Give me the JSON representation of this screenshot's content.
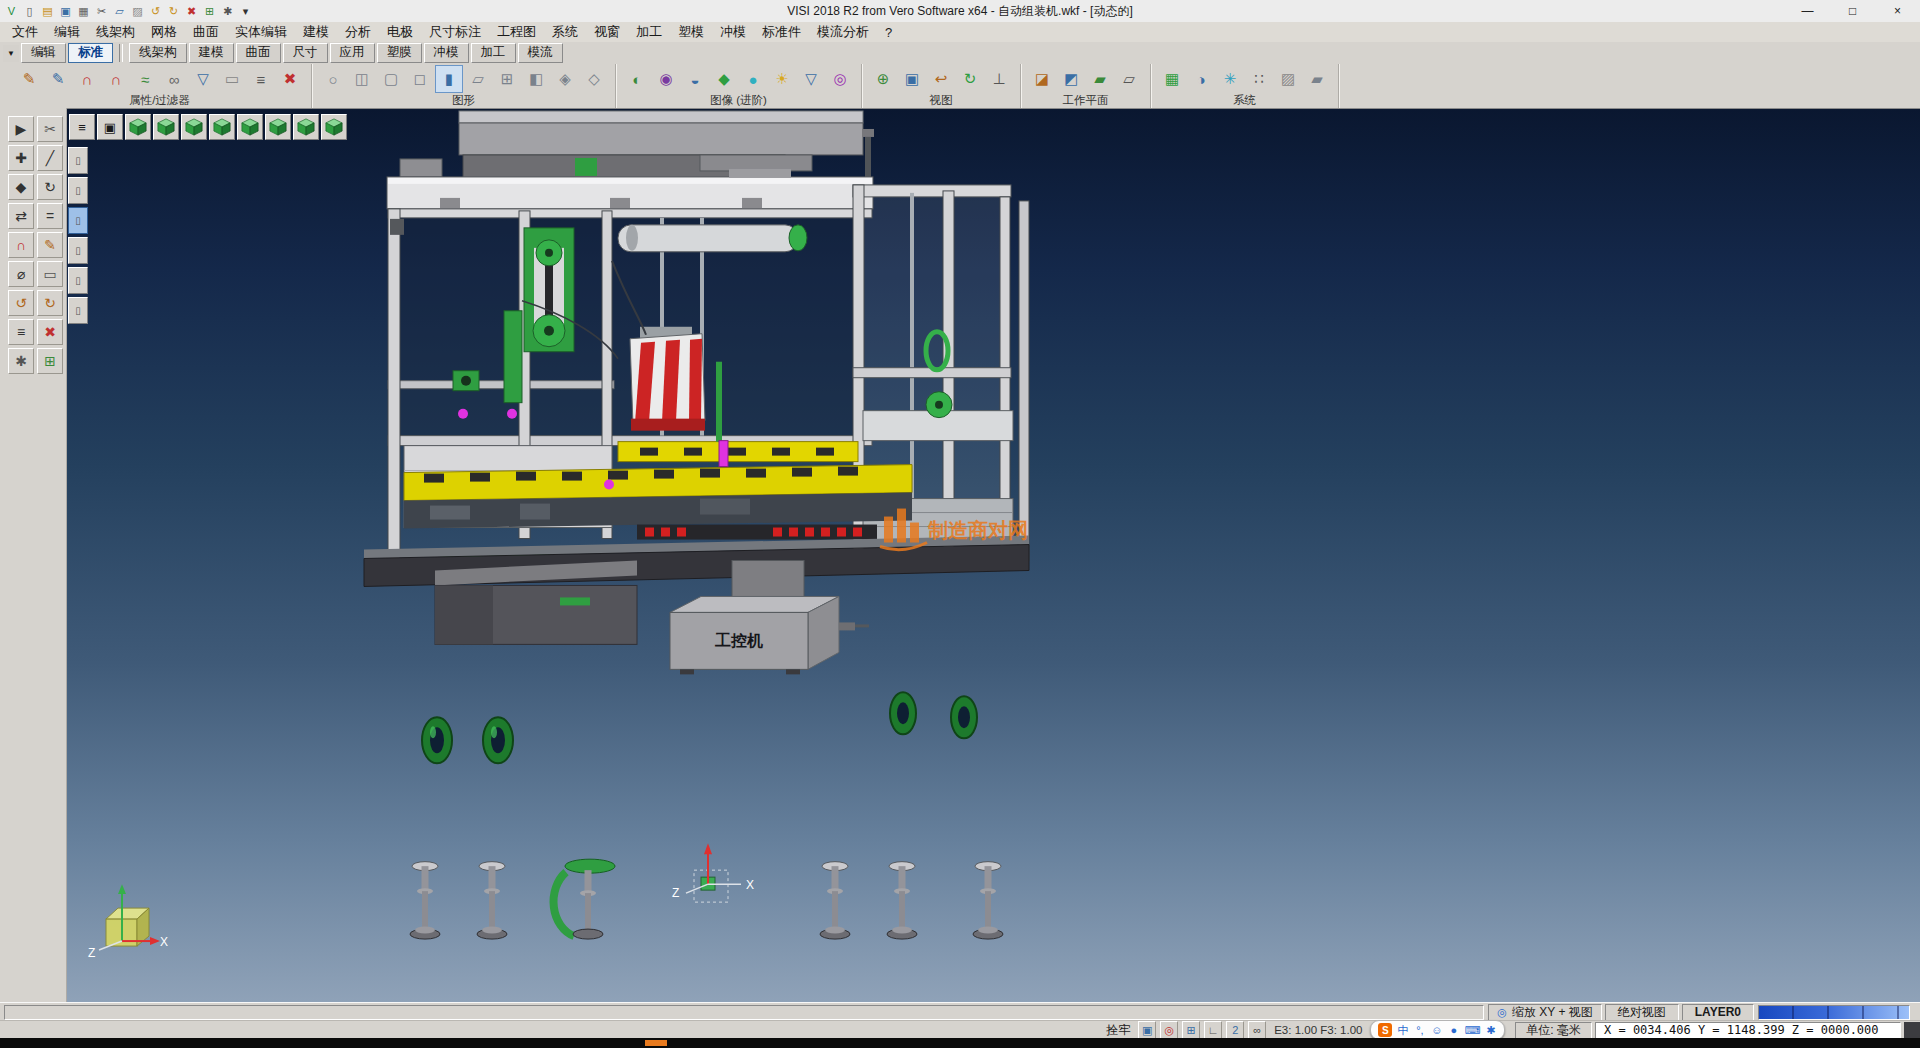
{
  "window": {
    "title": "VISI 2018 R2 from Vero Software x64 - 自动组装机.wkf - [动态的]",
    "controls": {
      "minimize": "—",
      "maximize": "□",
      "close": "×"
    },
    "quick_icons": [
      {
        "name": "visi-logo",
        "glyph": "V",
        "color": "#1c8c3c"
      },
      {
        "name": "new-file-icon",
        "glyph": "▯",
        "color": "#555555"
      },
      {
        "name": "open-file-icon",
        "glyph": "▤",
        "color": "#c89020"
      },
      {
        "name": "save-file-icon",
        "glyph": "▣",
        "color": "#3a6ea5"
      },
      {
        "name": "print-icon",
        "glyph": "▦",
        "color": "#666666"
      },
      {
        "name": "cut-icon",
        "glyph": "✂",
        "color": "#555555"
      },
      {
        "name": "copy-icon",
        "glyph": "▱",
        "color": "#3a6ea5"
      },
      {
        "name": "paste-icon",
        "glyph": "▨",
        "color": "#888888"
      },
      {
        "name": "undo-icon",
        "glyph": "↺",
        "color": "#c89020"
      },
      {
        "name": "redo-icon",
        "glyph": "↻",
        "color": "#c89020"
      },
      {
        "name": "delete-icon",
        "glyph": "✖",
        "color": "#c03030"
      },
      {
        "name": "grid-icon",
        "glyph": "⊞",
        "color": "#3a8a3a"
      },
      {
        "name": "options-icon",
        "glyph": "✱",
        "color": "#555555"
      },
      {
        "name": "more-commands-arrow",
        "glyph": "▾",
        "color": "#333333"
      }
    ]
  },
  "menubar": {
    "items": [
      {
        "label": "文件"
      },
      {
        "label": "编辑"
      },
      {
        "label": "线架构"
      },
      {
        "label": "网格"
      },
      {
        "label": "曲面"
      },
      {
        "label": "实体编辑"
      },
      {
        "label": "建模"
      },
      {
        "label": "分析"
      },
      {
        "label": "电极"
      },
      {
        "label": "尺寸标注"
      },
      {
        "label": "工程图"
      },
      {
        "label": "系统"
      },
      {
        "label": "视窗"
      },
      {
        "label": "加工"
      },
      {
        "label": "塑模"
      },
      {
        "label": "冲模"
      },
      {
        "label": "标准件"
      },
      {
        "label": "模流分析"
      },
      {
        "label": "?"
      }
    ]
  },
  "tabbar": {
    "dropdown": "▼",
    "left_tabs": [
      {
        "label": "编辑"
      },
      {
        "label": "标准",
        "cls": "active"
      }
    ],
    "right_tabs": [
      {
        "label": "线架构"
      },
      {
        "label": "建模"
      },
      {
        "label": "曲面"
      },
      {
        "label": "尺寸"
      },
      {
        "label": "应用"
      },
      {
        "label": "塑膜"
      },
      {
        "label": "冲模"
      },
      {
        "label": "加工"
      },
      {
        "label": "模流"
      }
    ]
  },
  "ribbon": {
    "groups": [
      {
        "label": "属性/过滤器",
        "icons": [
          {
            "name": "edit-attributes-icon",
            "glyph": "✎",
            "color": "#b06820"
          },
          {
            "name": "copy-attributes-icon",
            "glyph": "✎",
            "color": "#3a6ea5"
          },
          {
            "name": "magnet-filter-icon",
            "glyph": "∩",
            "color": "#c03030"
          },
          {
            "name": "magnet-select-icon",
            "glyph": "∩",
            "color": "#c03030"
          },
          {
            "name": "match-properties-icon",
            "glyph": "≈",
            "color": "#3a8a3a"
          },
          {
            "name": "link-elements-icon",
            "glyph": "∞",
            "color": "#666666"
          },
          {
            "name": "filter-icon",
            "glyph": "▽",
            "color": "#3a6ea5"
          },
          {
            "name": "erase-elements-icon",
            "glyph": "▭",
            "color": "#888888"
          },
          {
            "name": "layer-filter-icon",
            "glyph": "≡",
            "color": "#555555"
          },
          {
            "name": "reset-filter-icon",
            "glyph": "✖",
            "color": "#c03030"
          }
        ]
      },
      {
        "label": "图形",
        "icons": [
          {
            "name": "wireframe-view-icon",
            "glyph": "○",
            "color": "#7a828c"
          },
          {
            "name": "shaded-view-icon",
            "glyph": "◫",
            "color": "#7a828c"
          },
          {
            "name": "hidden-line-icon",
            "glyph": "▢",
            "color": "#7a828c"
          },
          {
            "name": "box-view-icon",
            "glyph": "◻",
            "color": "#7a828c"
          },
          {
            "name": "render-mode-icon",
            "glyph": "▮",
            "color": "#3a6ea5",
            "cls": "active"
          },
          {
            "name": "transparent-view-icon",
            "glyph": "▱",
            "color": "#7a828c"
          },
          {
            "name": "mesh-view-icon",
            "glyph": "⊞",
            "color": "#7a828c"
          },
          {
            "name": "half-section-icon",
            "glyph": "◧",
            "color": "#7a828c"
          },
          {
            "name": "gem-view-icon",
            "glyph": "◈",
            "color": "#7a828c"
          },
          {
            "name": "outline-view-icon",
            "glyph": "◇",
            "color": "#7a828c"
          }
        ]
      },
      {
        "label": "图像 (进阶)",
        "icons": [
          {
            "name": "render-settings-icon",
            "glyph": "◐",
            "color": "#3a8a3a"
          },
          {
            "name": "texture-view-icon",
            "glyph": "◉",
            "color": "#7a3aa0"
          },
          {
            "name": "shadow-view-icon",
            "glyph": "◒",
            "color": "#3a6ea5"
          },
          {
            "name": "material-icon",
            "glyph": "◆",
            "color": "#2f9e41"
          },
          {
            "name": "env-light-icon",
            "glyph": "●",
            "color": "#30b0c0"
          },
          {
            "name": "sun-light-icon",
            "glyph": "☀",
            "color": "#d8a820"
          },
          {
            "name": "clip-plane-icon",
            "glyph": "▽",
            "color": "#3a6ea5"
          },
          {
            "name": "analysis-view-icon",
            "glyph": "◎",
            "color": "#9a30b0"
          }
        ]
      },
      {
        "label": "视图",
        "icons": [
          {
            "name": "zoom-all-icon",
            "glyph": "⊕",
            "color": "#3a8a3a"
          },
          {
            "name": "zoom-window-icon",
            "glyph": "▣",
            "color": "#3a6ea5"
          },
          {
            "name": "previous-view-icon",
            "glyph": "↩",
            "color": "#b06820"
          },
          {
            "name": "rotate-view-icon",
            "glyph": "↻",
            "color": "#2f9e41"
          },
          {
            "name": "normal-view-icon",
            "glyph": "⊥",
            "color": "#555555"
          }
        ]
      },
      {
        "label": "工作平面",
        "icons": [
          {
            "name": "workplane-xy-icon",
            "glyph": "◪",
            "color": "#b06820"
          },
          {
            "name": "workplane-align-icon",
            "glyph": "◩",
            "color": "#3a6ea5"
          },
          {
            "name": "workplane-3pt-icon",
            "glyph": "▰",
            "color": "#3a8a3a"
          },
          {
            "name": "workplane-view-icon",
            "glyph": "▱",
            "color": "#555555"
          }
        ]
      },
      {
        "label": "系统",
        "icons": [
          {
            "name": "color-table-icon",
            "glyph": "▦",
            "color": "#2f9e41"
          },
          {
            "name": "globe-icon",
            "glyph": "◑",
            "color": "#3a6ea5"
          },
          {
            "name": "snowflake-icon",
            "glyph": "✳",
            "color": "#30a0c0"
          },
          {
            "name": "dot-grid-icon",
            "glyph": "∷",
            "color": "#555555"
          },
          {
            "name": "hatch-icon",
            "glyph": "▨",
            "color": "#888888"
          },
          {
            "name": "slanted-plane-icon",
            "glyph": "▰",
            "color": "#7a828c"
          }
        ]
      }
    ]
  },
  "left_toolbar": {
    "icons": [
      {
        "name": "select-arrow-icon",
        "glyph": "▶",
        "color": "#333333"
      },
      {
        "name": "trim-scissors-icon",
        "glyph": "✂",
        "color": "#555555"
      },
      {
        "name": "point-create-icon",
        "glyph": "✚",
        "color": "#333333"
      },
      {
        "name": "line-create-icon",
        "glyph": "╱",
        "color": "#333333"
      },
      {
        "name": "move-icon",
        "glyph": "◆",
        "color": "#333333"
      },
      {
        "name": "rotate-icon",
        "glyph": "↻",
        "color": "#333333"
      },
      {
        "name": "mirror-icon",
        "glyph": "⇄",
        "color": "#333333"
      },
      {
        "name": "offset-icon",
        "glyph": "=",
        "color": "#333333"
      },
      {
        "name": "magnet-icon",
        "glyph": "∩",
        "color": "#c03030"
      },
      {
        "name": "sketch-edit-icon",
        "glyph": "✎",
        "color": "#b06820"
      },
      {
        "name": "measure-icon",
        "glyph": "⌀",
        "color": "#333333"
      },
      {
        "name": "erase-icon",
        "glyph": "▭",
        "color": "#555555"
      },
      {
        "name": "undo-icon",
        "glyph": "↺",
        "color": "#b06820"
      },
      {
        "name": "redo-icon",
        "glyph": "↻",
        "color": "#b06820"
      },
      {
        "name": "layer-list-icon",
        "glyph": "≡",
        "color": "#333333"
      },
      {
        "name": "delete-icon",
        "glyph": "✖",
        "color": "#c03030"
      },
      {
        "name": "options-icon",
        "glyph": "✱",
        "color": "#555555"
      },
      {
        "name": "grid-toggle-icon",
        "glyph": "⊞",
        "color": "#3a8a3a"
      }
    ]
  },
  "view_toolbar": {
    "stack": {
      "name": "display-list-button",
      "glyph": "≡"
    },
    "window": {
      "name": "view-window-button",
      "glyph": "▣"
    },
    "cubes": [
      {
        "name": "iso-view-button-1"
      },
      {
        "name": "iso-view-button-2"
      },
      {
        "name": "iso-view-button-3"
      },
      {
        "name": "iso-view-button-4"
      },
      {
        "name": "iso-view-button-5"
      },
      {
        "name": "iso-view-button-6"
      },
      {
        "name": "iso-view-button-7"
      },
      {
        "name": "iso-view-button-8"
      }
    ]
  },
  "side_strip": {
    "buttons": [
      {
        "name": "display-filter-1",
        "glyph": "▯"
      },
      {
        "name": "display-filter-2",
        "glyph": "▯"
      },
      {
        "name": "display-filter-3",
        "glyph": "▯",
        "cls": "active"
      },
      {
        "name": "display-filter-4",
        "glyph": "▯"
      },
      {
        "name": "display-filter-5",
        "glyph": "▯"
      },
      {
        "name": "display-filter-6",
        "glyph": "▯"
      }
    ]
  },
  "viewport": {
    "machine_label": "工控机",
    "watermark_text": "制造商对网",
    "axis_x": "X",
    "axis_z": "Z",
    "colors": {
      "bg_top": "#0a1730",
      "bg_bottom": "#8fa2b8",
      "frame_gray": "#d4d4d6",
      "machine_green": "#2f9e41",
      "band_yellow": "#e2d600",
      "accent_magenta": "#e032e0",
      "watermark_orange": "#e87a1e"
    }
  },
  "statusbar": {
    "hint_icon": "◎",
    "hint": "缩放 XY + 视图",
    "view_mode": "绝对视图",
    "layer": "LAYER0",
    "lock_label": "拴牢",
    "scale_text": "E3: 1.00 F3: 1.00",
    "units": "单位: 毫米",
    "coords": "X = 0034.406 Y = 1148.399 Z = 0000.000",
    "tray_icons": [
      {
        "name": "autosave-icon",
        "glyph": "▣",
        "color": "#3a6ea5"
      },
      {
        "name": "target-snap-icon",
        "glyph": "◎",
        "color": "#c03030"
      },
      {
        "name": "grid-snap-icon",
        "glyph": "⊞",
        "color": "#3a6ea5"
      },
      {
        "name": "ortho-icon",
        "glyph": "∟",
        "color": "#555555"
      },
      {
        "name": "layer-2-icon",
        "glyph": "2",
        "color": "#3a6ea5"
      },
      {
        "name": "preview-glasses-icon",
        "glyph": "∞",
        "color": "#444444"
      }
    ],
    "ime_icons": [
      {
        "name": "sogou-logo",
        "glyph": "S",
        "cls": "sogou"
      },
      {
        "name": "ime-lang-chinese",
        "glyph": "中"
      },
      {
        "name": "ime-punctuation",
        "glyph": "°,"
      },
      {
        "name": "ime-emoji-picker",
        "glyph": "☺"
      },
      {
        "name": "ime-voice-input",
        "glyph": "●"
      },
      {
        "name": "ime-keyboard",
        "glyph": "⌨"
      },
      {
        "name": "ime-toolbox",
        "glyph": "✱"
      }
    ]
  }
}
